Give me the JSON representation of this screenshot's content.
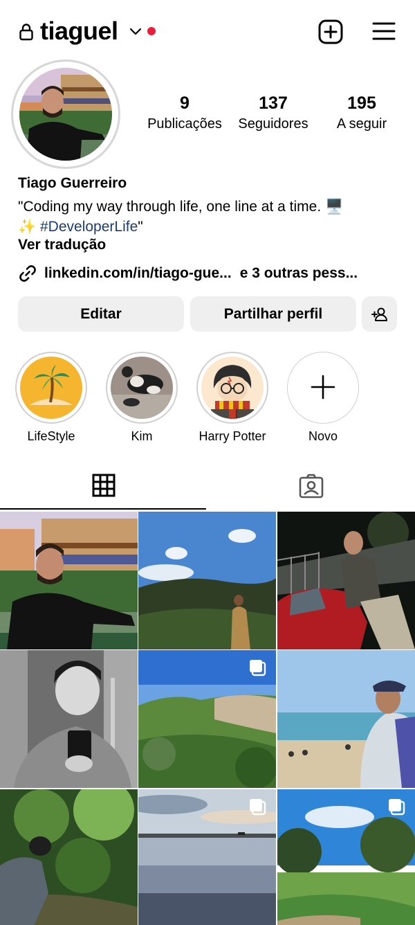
{
  "header": {
    "username": "tiaguel",
    "lock_icon": "lock-icon",
    "dropdown_icon": "chevron-down-icon",
    "notification_color": "#ed1c3b",
    "add_icon": "add-post-icon",
    "menu_icon": "hamburger-menu-icon"
  },
  "profile": {
    "stats": [
      {
        "value": "9",
        "label": "Publicações"
      },
      {
        "value": "137",
        "label": "Seguidores"
      },
      {
        "value": "195",
        "label": "A seguir"
      }
    ],
    "name": "Tiago Guerreiro",
    "bio_line1": "\"Coding my way through life, one line at a time. 🖥️",
    "bio_line2_prefix": "✨ ",
    "bio_hashtag": "#DeveloperLife",
    "bio_line2_suffix": "\"",
    "translate": "Ver tradução",
    "link": "linkedin.com/in/tiago-gue...",
    "link_others": "e 3 outras pess..."
  },
  "actions": {
    "edit": "Editar",
    "share": "Partilhar perfil",
    "add_user_icon": "add-user-icon"
  },
  "highlights": [
    {
      "label": "LifeStyle"
    },
    {
      "label": "Kim"
    },
    {
      "label": "Harry Potter"
    },
    {
      "label": "Novo"
    }
  ],
  "tabs": {
    "grid_icon": "grid-icon",
    "tagged_icon": "tagged-icon"
  },
  "colors": {
    "hashtag": "#1b3c73",
    "button_bg": "#efefef"
  }
}
